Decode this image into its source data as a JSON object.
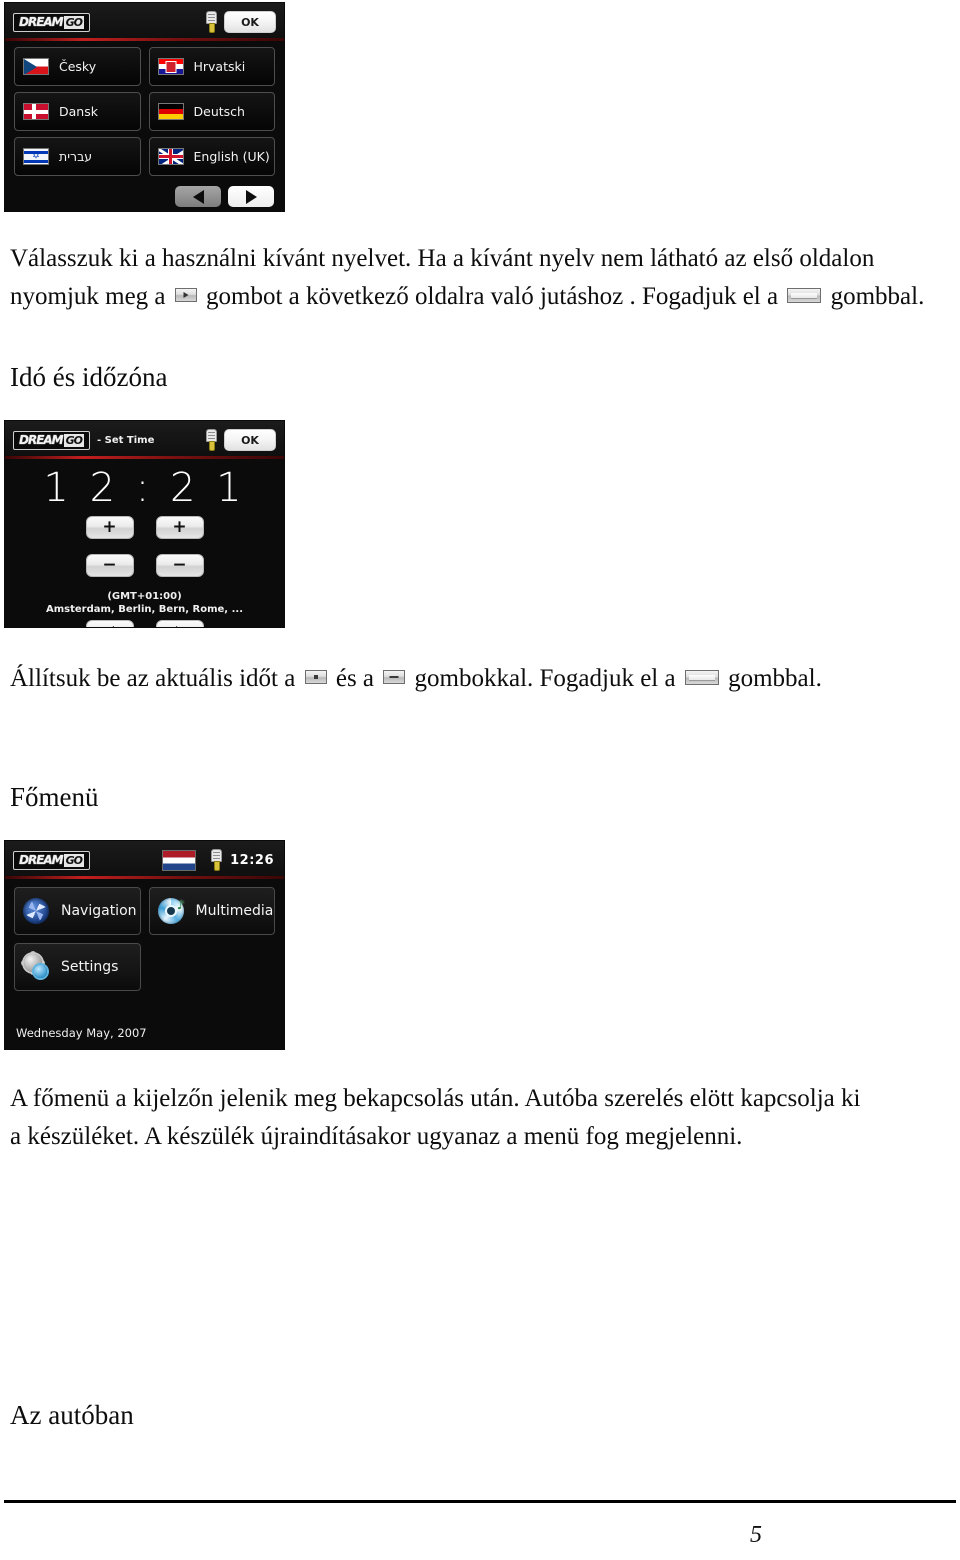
{
  "document": {
    "page_number": "5"
  },
  "screen_language": {
    "title_logo": "DREAM",
    "title_logo_suffix": "GO",
    "ok_label": "OK",
    "usb_icon": "usb-battery-icon",
    "languages": [
      {
        "label": "Česky",
        "flag": "flag-czech-republic",
        "rtl": false
      },
      {
        "label": "Hrvatski",
        "flag": "flag-croatia",
        "rtl": false
      },
      {
        "label": "Dansk",
        "flag": "flag-denmark",
        "rtl": false
      },
      {
        "label": "Deutsch",
        "flag": "flag-germany",
        "rtl": false
      },
      {
        "label": "עברית",
        "flag": "flag-israel",
        "rtl": true
      },
      {
        "label": "English (UK)",
        "flag": "flag-united-kingdom",
        "rtl": false
      }
    ],
    "prev_arrow": "◀",
    "next_arrow": "▶"
  },
  "paragraph_language": {
    "line1_a": "Válasszuk ki a használni kívánt nyelvet.",
    "line1_b": " Ha a kívánt nyelv nem látható az első oldalon",
    "line2_a": "nyomjuk meg a",
    "line2_b": "gombot a következő oldalra való jutáshoz . Fogadjuk el a",
    "line2_c": "gombbal."
  },
  "heading_time": "Idó és időzóna",
  "screen_time": {
    "title_logo": "DREAM",
    "title_logo_suffix": "GO",
    "title_sub": "- Set Time",
    "ok_label": "OK",
    "usb_icon": "usb-battery-icon",
    "clock": "1 2 : 2 1",
    "plus_hours": "+",
    "plus_minutes": "+",
    "minus_hours": "−",
    "minus_minutes": "−",
    "timezone_offset": "(GMT+01:00)",
    "timezone_cities": "Amsterdam, Berlin, Bern, Rome, ...",
    "prev_arrow": "◀",
    "next_arrow": "▶"
  },
  "paragraph_time": {
    "a": "Állítsuk be az aktuális időt a",
    "b": "és a",
    "c": "gombokkal. Fogadjuk el a",
    "d": "gombbal."
  },
  "heading_menu": "Főmenü",
  "screen_menu": {
    "title_logo": "DREAM",
    "title_logo_suffix": "GO",
    "flag": "flag-netherlands",
    "usb_icon": "usb-battery-icon",
    "time": "12:26",
    "items": [
      {
        "label": "Navigation",
        "icon": "navigation-compass-icon"
      },
      {
        "label": "Multimedia",
        "icon": "multimedia-disc-icon"
      },
      {
        "label": "Settings",
        "icon": "settings-gears-icon"
      }
    ],
    "date": "Wednesday May, 2007"
  },
  "paragraph_menu": {
    "line1": "A főmenü a kijelzőn jelenik meg bekapcsolás után. Autóba szerelés elött kapcsolja ki",
    "line2": "a készüléket. A készülék újraindításakor ugyanaz a menü fog megjelenni."
  },
  "heading_car": "Az autóban"
}
